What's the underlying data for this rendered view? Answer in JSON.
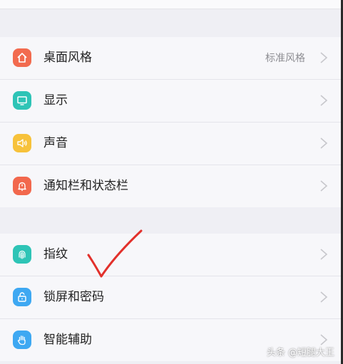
{
  "settings": {
    "group1": [
      {
        "label": "桌面风格",
        "value": "标准风格",
        "icon": "home-icon",
        "color": "#f26b4f"
      },
      {
        "label": "显示",
        "icon": "display-icon",
        "color": "#2ec4b6"
      },
      {
        "label": "声音",
        "icon": "speaker-icon",
        "color": "#f7c23b"
      },
      {
        "label": "通知栏和状态栏",
        "icon": "bell-icon",
        "color": "#f2684d"
      }
    ],
    "group2": [
      {
        "label": "指纹",
        "icon": "fingerprint-icon",
        "color": "#2ec4b6"
      },
      {
        "label": "锁屏和密码",
        "icon": "lock-icon",
        "color": "#3ea8f2"
      },
      {
        "label": "智能辅助",
        "icon": "hand-icon",
        "color": "#3ea8f2"
      }
    ]
  },
  "watermark": "头条 @短腿大王",
  "annotation_color": "#e2302b"
}
